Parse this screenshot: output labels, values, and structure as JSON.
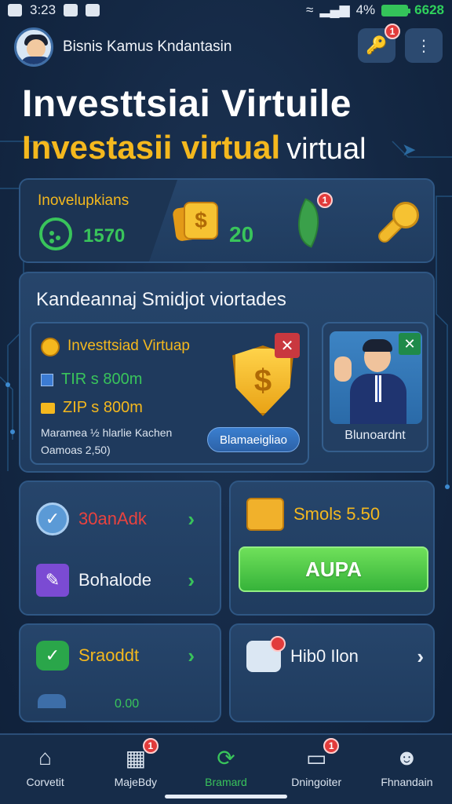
{
  "status_bar": {
    "time_left": "3:23",
    "battery": "4%",
    "time_right": "6628"
  },
  "header": {
    "title": "Bisnis Kamus Kndantasin",
    "key_badge": "1"
  },
  "hero": {
    "line1": "Investtsiai Virtuile",
    "line2_gold": "Investasii virtual",
    "line2_white": "virtual"
  },
  "stats": {
    "label": "Inovelupkians",
    "value": "1570",
    "coins": "20",
    "leaf_badge": "1",
    "coin_symbol": "$"
  },
  "recommend": {
    "title": "Kandeannaj Smidjot viortades",
    "investment": {
      "title": "Investtsiad Virtuap",
      "row1": "TIR s 800m",
      "row2": "ZIP s 800m",
      "desc1": "Maramea ½ hlarlie Kachen",
      "desc2": "Oamoas 2,50)",
      "button": "Blamaeigliao",
      "close": "✕"
    },
    "advisor": {
      "name": "Blunoardnt",
      "close": "✕"
    }
  },
  "tiles": {
    "t1_a": "30anAdk",
    "t1_b": "Bohalode",
    "t2_label": "Smols 5.50",
    "t2_button": "AUPA",
    "t3_label": "Sraoddt",
    "t3_sub": "0.00",
    "t4_label": "Hib0 Ilon"
  },
  "nav": [
    {
      "label": "Corvetit",
      "icon": "home-icon"
    },
    {
      "label": "MajeBdy",
      "icon": "calendar-icon",
      "badge": "1"
    },
    {
      "label": "Bramard",
      "icon": "refresh-icon"
    },
    {
      "label": "Dningoiter",
      "icon": "tablet-icon",
      "badge": "1"
    },
    {
      "label": "Fhnandain",
      "icon": "user-icon"
    }
  ],
  "colors": {
    "accent_gold": "#f4b81e",
    "accent_green": "#39c45b",
    "background": "#142844",
    "badge_red": "#e23b3b"
  }
}
